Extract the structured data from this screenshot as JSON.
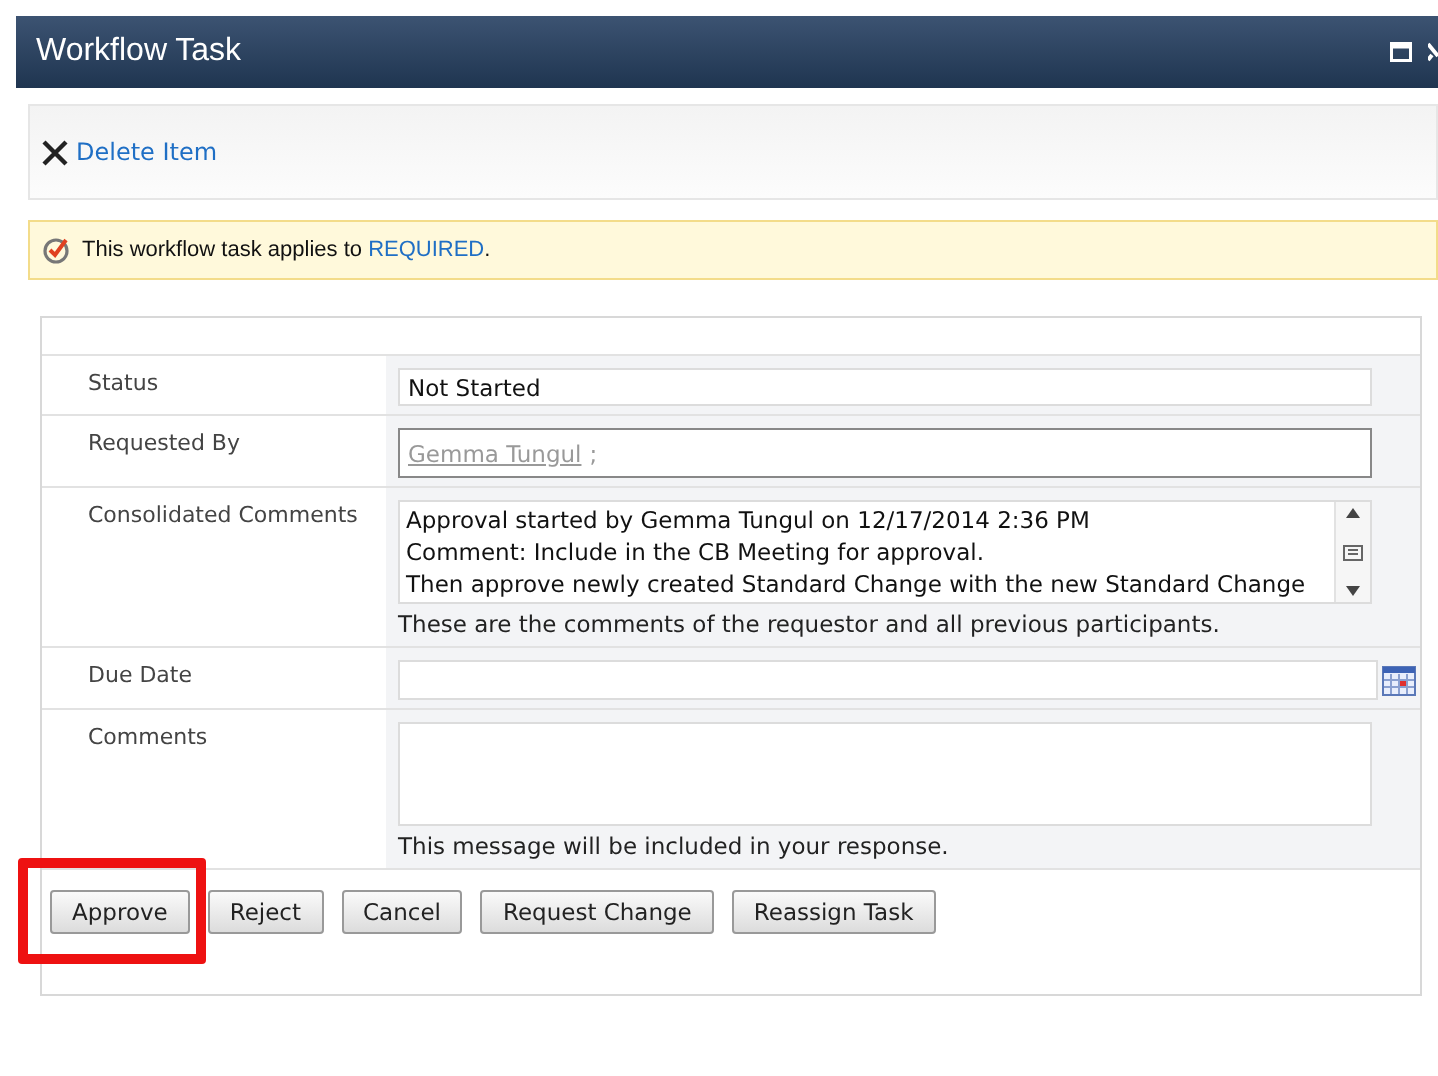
{
  "window": {
    "title": "Workflow Task"
  },
  "toolbar": {
    "items": [
      {
        "label": "Delete Item"
      }
    ]
  },
  "notice": {
    "text": "This workflow task applies to",
    "link": "REQUIRED",
    "tail": "."
  },
  "form": {
    "rows": [
      {
        "kind": "text",
        "label": "Status",
        "value": "Not Started"
      },
      {
        "kind": "people",
        "label": "Requested By",
        "value": "Gemma Tungul",
        "suffix": ";"
      },
      {
        "kind": "history",
        "label": "Consolidated Comments",
        "lines": [
          "Approval started by Gemma Tungul on 12/17/2014 2:36 PM",
          "Comment: Include in the CB Meeting for approval.",
          "Then approve newly created Standard Change with the new Standard Change"
        ],
        "hint": "These are the comments of the requestor and all previous participants."
      },
      {
        "kind": "date",
        "label": "Due Date"
      },
      {
        "kind": "textarea",
        "label": "Comments",
        "hint": "This message will be included in your response."
      }
    ]
  },
  "buttons": [
    {
      "label": "Approve",
      "highlighted": true
    },
    {
      "label": "Reject",
      "highlighted": false
    },
    {
      "label": "Cancel",
      "highlighted": false
    },
    {
      "label": "Request Change",
      "highlighted": false
    },
    {
      "label": "Reassign Task",
      "highlighted": false
    }
  ]
}
